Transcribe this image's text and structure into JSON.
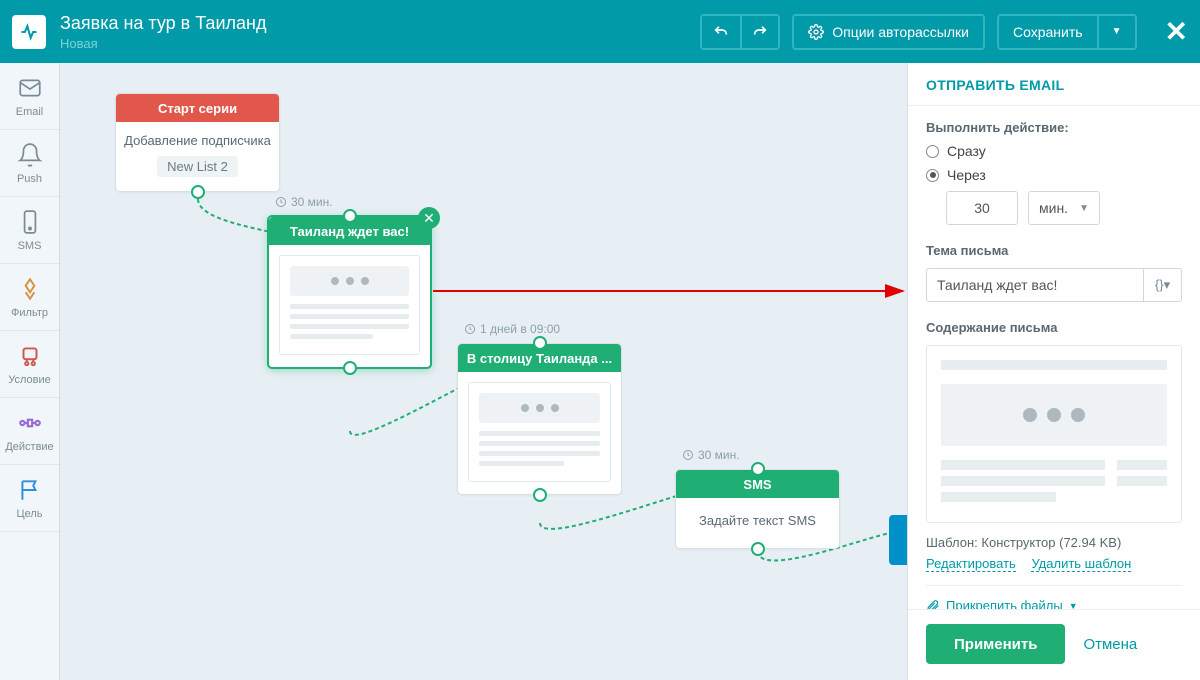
{
  "header": {
    "title": "Заявка на тур в Таиланд",
    "subtitle": "Новая",
    "options_label": "Опции авторассылки",
    "save_label": "Сохранить"
  },
  "sidebar": {
    "items": [
      {
        "label": "Email"
      },
      {
        "label": "Push"
      },
      {
        "label": "SMS"
      },
      {
        "label": "Фильтр"
      },
      {
        "label": "Условие"
      },
      {
        "label": "Действие"
      },
      {
        "label": "Цель"
      }
    ]
  },
  "nodes": {
    "start": {
      "title": "Старт серии",
      "text": "Добавление подписчика",
      "list": "New List 2"
    },
    "n1": {
      "delay": "30 мин.",
      "title": "Таиланд ждет вас!"
    },
    "n2": {
      "delay": "1 дней в 09:00",
      "title": "В столицу Таиланда ..."
    },
    "n3": {
      "delay": "30 мин.",
      "title": "SMS",
      "text": "Задайте текст SMS"
    }
  },
  "panel": {
    "title": "ОТПРАВИТЬ EMAIL",
    "action_label": "Выполнить действие:",
    "radio_now": "Сразу",
    "radio_after": "Через",
    "delay_value": "30",
    "delay_unit": "мин.",
    "subject_label": "Тема письма",
    "subject_value": "Таиланд ждет вас!",
    "var_btn": "{}▾",
    "content_label": "Содержание письма",
    "template_label": "Шаблон:",
    "template_name": "Конструктор (72.94 KB)",
    "edit_link": "Редактировать",
    "delete_link": "Удалить шаблон",
    "attach_label": "Прикрепить файлы",
    "apply": "Применить",
    "cancel": "Отмена"
  }
}
